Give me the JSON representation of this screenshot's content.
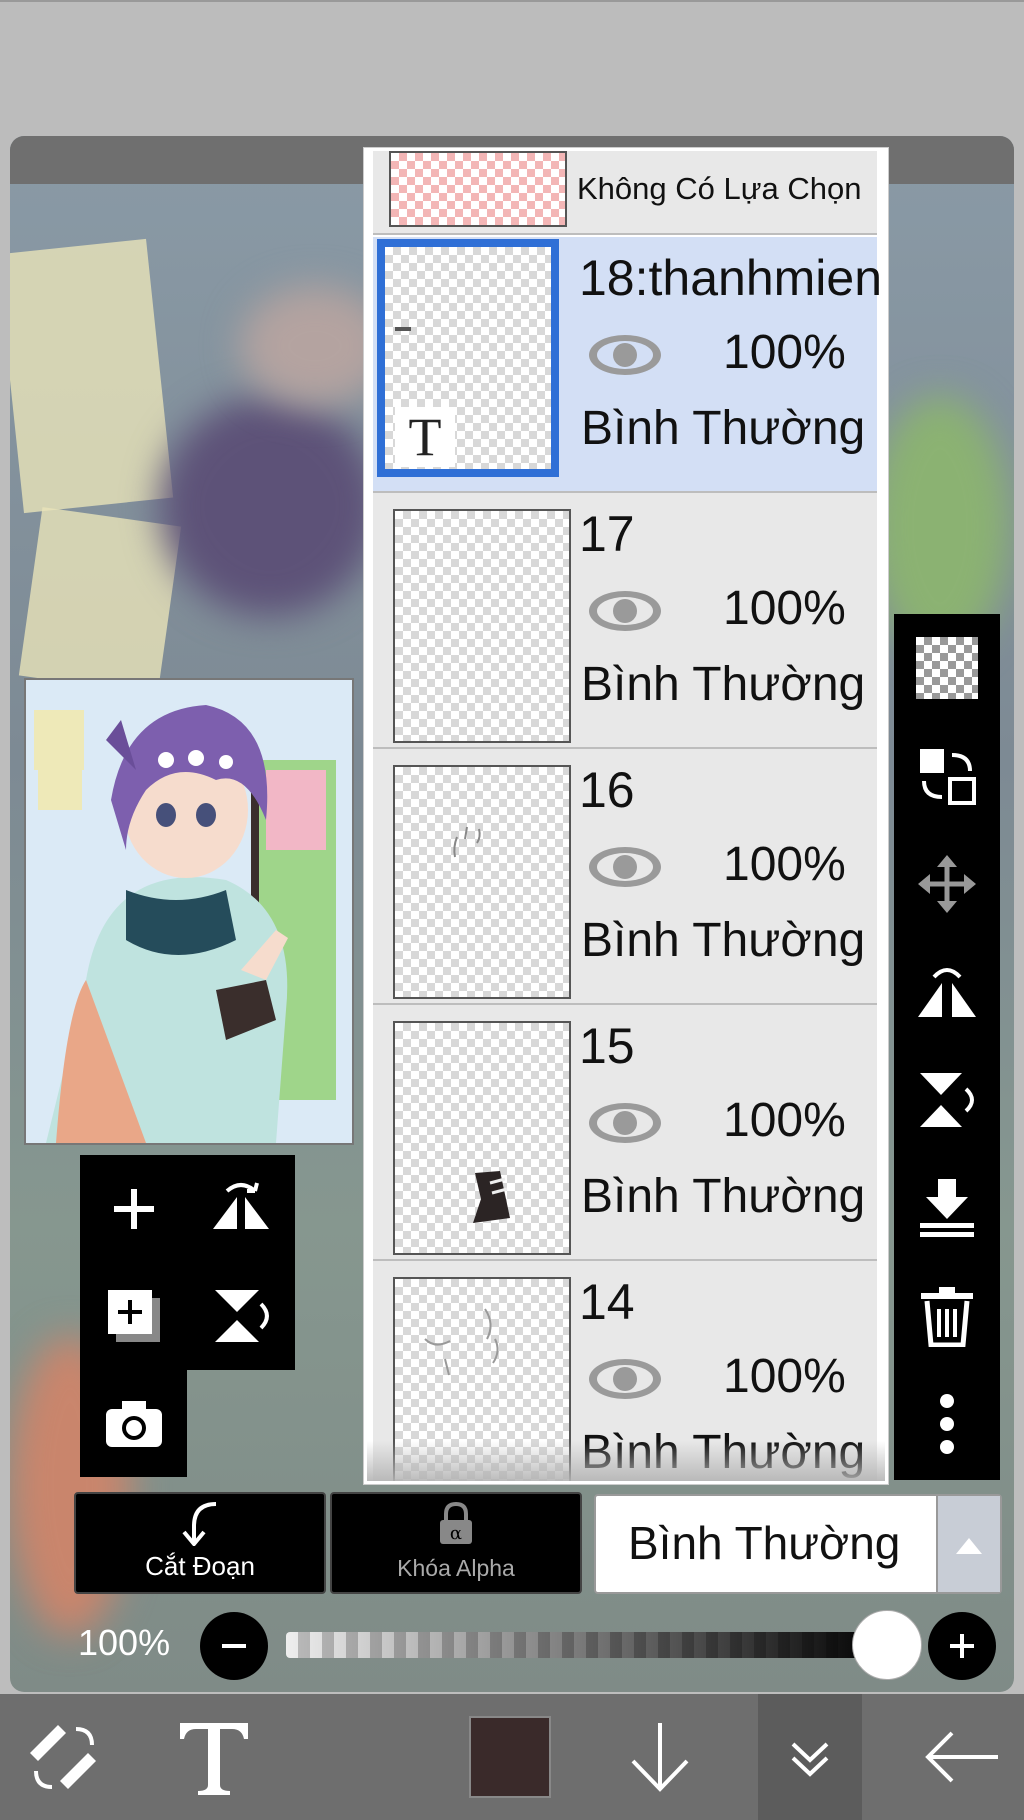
{
  "layers_panel": {
    "selection_layer_label": "Không Có Lựa Chọn",
    "layers": [
      {
        "name": "18:thanhmien",
        "opacity": "100%",
        "blend": "Bình Thường",
        "selected": true,
        "badge": "T"
      },
      {
        "name": "17",
        "opacity": "100%",
        "blend": "Bình Thường",
        "selected": false
      },
      {
        "name": "16",
        "opacity": "100%",
        "blend": "Bình Thường",
        "selected": false
      },
      {
        "name": "15",
        "opacity": "100%",
        "blend": "Bình Thường",
        "selected": false
      },
      {
        "name": "14",
        "opacity": "100%",
        "blend": "Bình Thường",
        "selected": false
      }
    ]
  },
  "controls": {
    "clip_label": "Cắt Đoạn",
    "alpha_lock_label": "Khóa Alpha",
    "blend_mode": "Bình Thường",
    "opacity_value": "100%",
    "opacity_level": 1.0
  },
  "colors": {
    "current_color": "#3a2a2a",
    "selected_layer_bg": "#d3dff5",
    "selected_border": "#2f6fd6"
  },
  "icons": {
    "right_tools": [
      "transparency-icon",
      "swap-layer-icon",
      "move-icon",
      "flip-horizontal-icon",
      "flip-vertical-icon",
      "merge-down-icon",
      "delete-icon",
      "more-icon"
    ],
    "layer_tools": [
      "add-layer-icon",
      "flip-layer-horizontal-icon",
      "duplicate-layer-icon",
      "flip-layer-vertical-icon",
      "camera-icon"
    ],
    "bottom_bar": [
      "brush-eraser-swap-icon",
      "text-tool-icon",
      "color-swatch",
      "download-icon",
      "collapse-icon",
      "back-arrow-icon"
    ]
  }
}
